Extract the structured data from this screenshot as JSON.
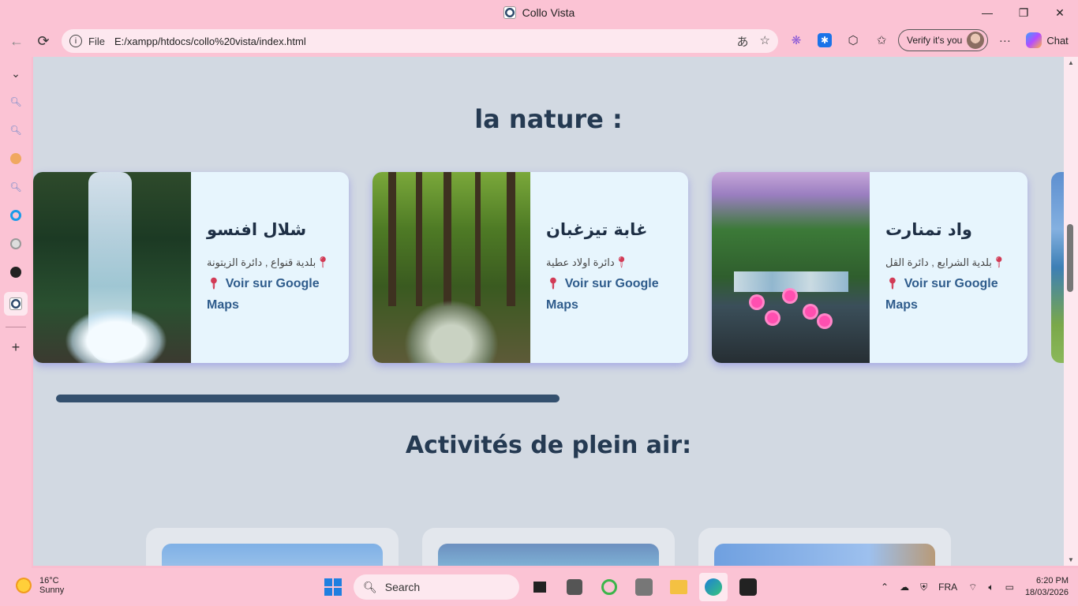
{
  "window": {
    "title": "Collo Vista",
    "minimize": "—",
    "restore": "❐",
    "close": "✕"
  },
  "address_bar": {
    "file_label": "File",
    "url": "E:/xampp/htdocs/collo%20vista/index.html"
  },
  "toolbar": {
    "verify_label": "Verify it's you",
    "chat_label": "Chat",
    "more": "···"
  },
  "page": {
    "section_nature_title": "la nature :",
    "cards": [
      {
        "name": "شلال افنسو",
        "address": "بلدية قنواع , دائرة الزيتونة",
        "maps_label": "Voir sur Google Maps"
      },
      {
        "name": "غابة تيزغبان",
        "address": "دائرة اولاد عطية",
        "maps_label": "Voir sur Google Maps"
      },
      {
        "name": "واد تمنارت",
        "address": "بلدية الشرايع , دائرة القل",
        "maps_label": "Voir sur Google Maps"
      }
    ],
    "section_activities_title": "Activités de plein air:"
  },
  "taskbar": {
    "weather_temp": "16°C",
    "weather_desc": "Sunny",
    "search_label": "Search",
    "language": "FRA",
    "time": "6:20 PM",
    "date": "18/03/2026"
  },
  "colors": {
    "page_bg": "#d2d9e2",
    "title_text": "#253a52",
    "card_bg": "#e7f5fd",
    "maps_link": "#2f5c8c",
    "chrome_pink": "#fbc3d4"
  }
}
